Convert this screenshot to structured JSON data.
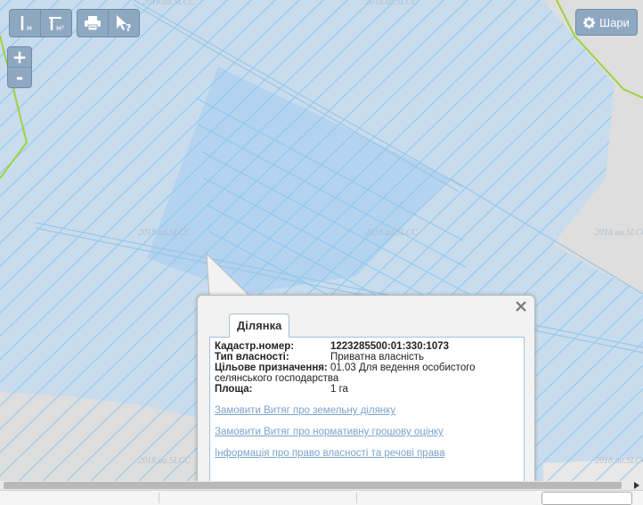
{
  "toolbar": {
    "measure_length_unit": "м",
    "measure_area_unit": "м²",
    "layers_label": "Шари"
  },
  "zoom": {
    "in_label": "+",
    "out_label": "-"
  },
  "watermark": "2018.ua.SLCC",
  "popup": {
    "tab_label": "Ділянка",
    "fields": [
      {
        "label": "Кадастр.номер:",
        "value": "1223285500:01:330:1073"
      },
      {
        "label": "Тип власності:",
        "value": "Приватна власність"
      },
      {
        "label": "Цільове призначення:",
        "value": "01.03 Для ведення особистого"
      },
      {
        "label": "",
        "value": "селянського господарства"
      },
      {
        "label": "Площа:",
        "value": "1 га"
      }
    ],
    "links": [
      "Замовити Витяг про земельну ділянку",
      "Замовити Витяг про нормативну грошову оцінку",
      "Інформація про право власності та речові права"
    ]
  },
  "colors": {
    "parcel_fill": "#c8dced",
    "parcel_selected": "#b3d3ef",
    "parcel_line": "#8cc8ef",
    "boundary_green": "#9fd23a",
    "toolbar_bg": "#8fa8c2",
    "link": "#7aa4cc"
  }
}
